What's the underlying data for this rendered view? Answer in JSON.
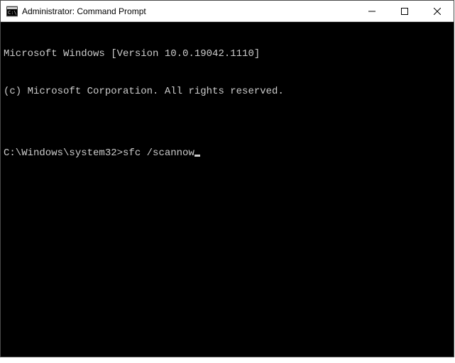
{
  "titlebar": {
    "title": "Administrator: Command Prompt",
    "icon_name": "cmd-icon"
  },
  "window_controls": {
    "minimize_name": "minimize-button",
    "maximize_name": "maximize-button",
    "close_name": "close-button"
  },
  "terminal": {
    "lines": [
      "Microsoft Windows [Version 10.0.19042.1110]",
      "(c) Microsoft Corporation. All rights reserved.",
      ""
    ],
    "prompt": "C:\\Windows\\system32>",
    "command": "sfc /scannow"
  },
  "colors": {
    "terminal_bg": "#000000",
    "terminal_fg": "#cccccc",
    "titlebar_bg": "#ffffff"
  }
}
